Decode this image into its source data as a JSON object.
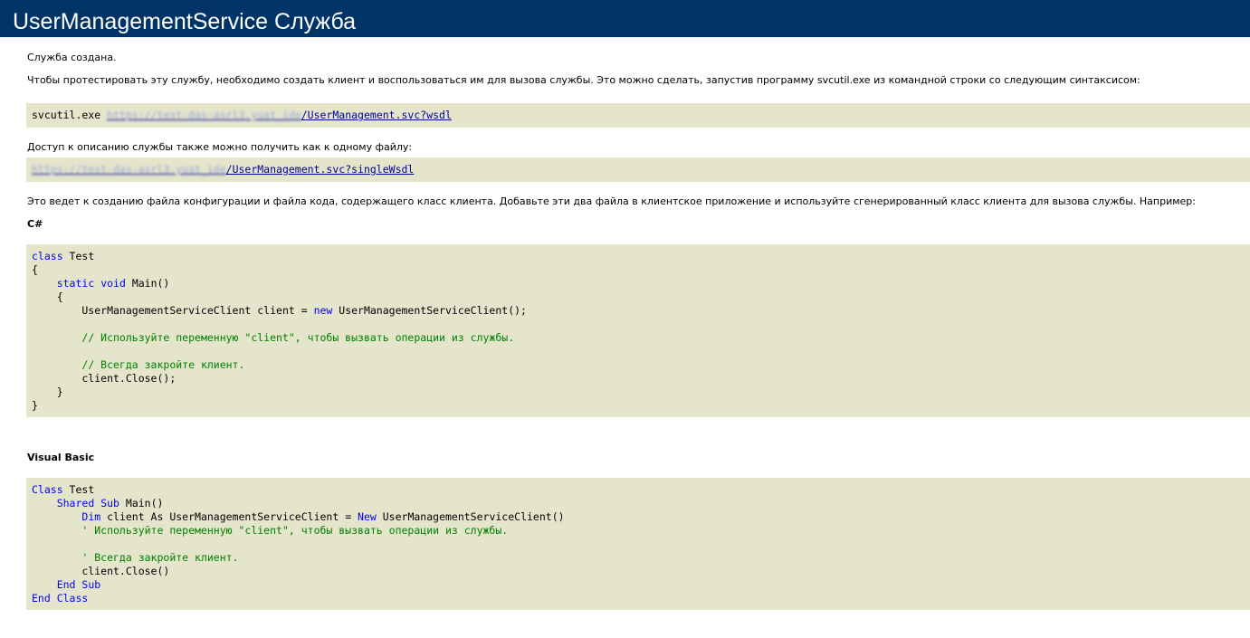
{
  "header": {
    "title": "UserManagementService Служба"
  },
  "intro": {
    "created": "Служба создана.",
    "instructions": "Чтобы протестировать эту службу, необходимо создать клиент и воспользоваться им для вызова службы. Это можно сделать, запустив программу svcutil.exe из командной строки со следующим синтаксисом:"
  },
  "svcutil": {
    "command": "svcutil.exe ",
    "host_blurred": "https://test-das-asrl3.yuat_ide",
    "path": "/UserManagement.svc?wsdl"
  },
  "single_file": {
    "text": "Доступ к описанию службы также можно получить как к одному файлу:",
    "host_blurred": "https://test-das-asrl3.yuat_ide",
    "path": "/UserManagement.svc?singleWsdl"
  },
  "explanation": "Это ведет к созданию файла конфигурации и файла кода, содержащего класс клиента. Добавьте эти два файла в клиентское приложение и используйте сгенерированный класс клиента для вызова службы. Например:",
  "csharp": {
    "label": "C#",
    "lines": [
      [
        {
          "t": "class",
          "k": "kw"
        },
        {
          "t": " Test"
        }
      ],
      [
        {
          "t": "{"
        }
      ],
      [
        {
          "t": "    "
        },
        {
          "t": "static",
          "k": "kw"
        },
        {
          "t": " "
        },
        {
          "t": "void",
          "k": "kw"
        },
        {
          "t": " Main()"
        }
      ],
      [
        {
          "t": "    {"
        }
      ],
      [
        {
          "t": "        UserManagementServiceClient client = "
        },
        {
          "t": "new",
          "k": "kw"
        },
        {
          "t": " UserManagementServiceClient();"
        }
      ],
      [
        {
          "t": ""
        }
      ],
      [
        {
          "t": "        "
        },
        {
          "t": "// Используйте переменную \"client\", чтобы вызвать операции из службы.",
          "k": "cm"
        }
      ],
      [
        {
          "t": ""
        }
      ],
      [
        {
          "t": "        "
        },
        {
          "t": "// Всегда закройте клиент.",
          "k": "cm"
        }
      ],
      [
        {
          "t": "        client.Close();"
        }
      ],
      [
        {
          "t": "    }"
        }
      ],
      [
        {
          "t": "}"
        }
      ]
    ]
  },
  "vb": {
    "label": "Visual Basic",
    "lines": [
      [
        {
          "t": "Class",
          "k": "kw"
        },
        {
          "t": " Test"
        }
      ],
      [
        {
          "t": "    "
        },
        {
          "t": "Shared",
          "k": "kw"
        },
        {
          "t": " "
        },
        {
          "t": "Sub",
          "k": "kw"
        },
        {
          "t": " Main()"
        }
      ],
      [
        {
          "t": "        "
        },
        {
          "t": "Dim",
          "k": "kw"
        },
        {
          "t": " client As UserManagementServiceClient = "
        },
        {
          "t": "New",
          "k": "kw"
        },
        {
          "t": " UserManagementServiceClient()"
        }
      ],
      [
        {
          "t": "        "
        },
        {
          "t": "' Используйте переменную \"client\", чтобы вызвать операции из службы.",
          "k": "cm"
        }
      ],
      [
        {
          "t": ""
        }
      ],
      [
        {
          "t": "        "
        },
        {
          "t": "' Всегда закройте клиент.",
          "k": "cm"
        }
      ],
      [
        {
          "t": "        client.Close()"
        }
      ],
      [
        {
          "t": "    "
        },
        {
          "t": "End Sub",
          "k": "kw"
        }
      ],
      [
        {
          "t": "End Class",
          "k": "kw"
        }
      ]
    ]
  }
}
